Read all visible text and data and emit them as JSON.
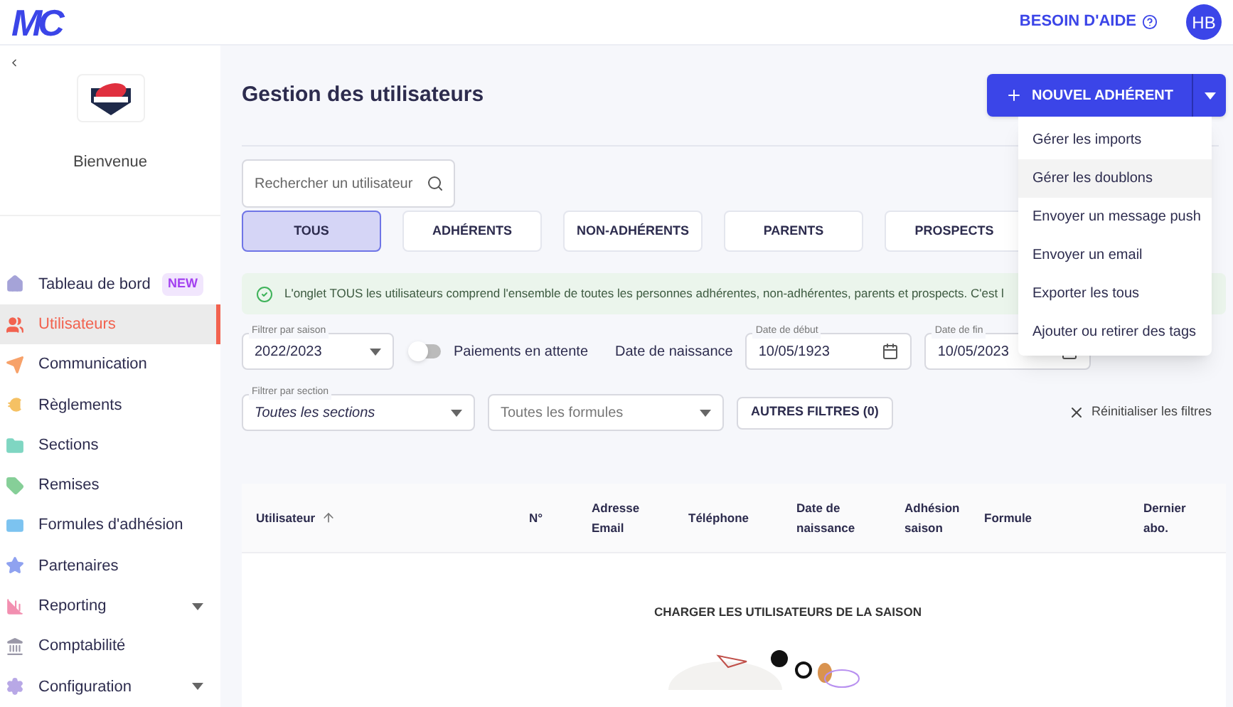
{
  "header": {
    "logo": "MC",
    "help": "BESOIN D'AIDE",
    "avatar": "HB"
  },
  "sidebar": {
    "welcome": "Bienvenue",
    "items": [
      {
        "label": "Tableau de bord",
        "selected": false,
        "badge": "NEW",
        "expandable": false
      },
      {
        "label": "Utilisateurs",
        "selected": true,
        "expandable": false
      },
      {
        "label": "Communication",
        "selected": false,
        "expandable": false
      },
      {
        "label": "Règlements",
        "selected": false,
        "expandable": false
      },
      {
        "label": "Sections",
        "selected": false,
        "expandable": false
      },
      {
        "label": "Remises",
        "selected": false,
        "expandable": false
      },
      {
        "label": "Formules d'adhésion",
        "selected": false,
        "expandable": false
      },
      {
        "label": "Partenaires",
        "selected": false,
        "expandable": false
      },
      {
        "label": "Reporting",
        "selected": false,
        "expandable": true
      },
      {
        "label": "Comptabilité",
        "selected": false,
        "expandable": false
      },
      {
        "label": "Configuration",
        "selected": false,
        "expandable": true
      }
    ]
  },
  "page": {
    "title": "Gestion des utilisateurs",
    "new_button": "NOUVEL ADHÉRENT"
  },
  "menu": [
    {
      "label": "Gérer les imports",
      "hovered": false
    },
    {
      "label": "Gérer les doublons",
      "hovered": true
    },
    {
      "label": "Envoyer un message push",
      "hovered": false
    },
    {
      "label": "Envoyer un email",
      "hovered": false
    },
    {
      "label": "Exporter les tous",
      "hovered": false
    },
    {
      "label": "Ajouter ou retirer des tags",
      "hovered": false
    }
  ],
  "search": {
    "placeholder": "Rechercher un utilisateur"
  },
  "tabs": [
    {
      "label": "TOUS",
      "selected": true
    },
    {
      "label": "ADHÉRENTS",
      "selected": false
    },
    {
      "label": "NON-ADHÉRENTS",
      "selected": false
    },
    {
      "label": "PARENTS",
      "selected": false
    },
    {
      "label": "PROSPECTS",
      "selected": false
    }
  ],
  "info": "L'onglet TOUS les utilisateurs comprend l'ensemble de toutes les personnes adhérentes, non-adhérentes, parents et prospects. C'est l",
  "filters": {
    "season": {
      "label": "Filtrer par saison",
      "value": "2022/2023"
    },
    "pending": {
      "label": "Paiements en attente",
      "on": false
    },
    "birth_label": "Date de naissance",
    "start": {
      "label": "Date de début",
      "value": "10/05/1923"
    },
    "end": {
      "label": "Date de fin",
      "value": "10/05/2023"
    },
    "section": {
      "label": "Filtrer par section",
      "value": "Toutes les sections"
    },
    "formula": {
      "placeholder": "Toutes les formules"
    },
    "more": "AUTRES FILTRES (0)",
    "reset": "Réinitialiser les filtres"
  },
  "table": {
    "columns": [
      "Utilisateur",
      "N°",
      "Adresse Email",
      "Téléphone",
      "Date de naissance",
      "Adhésion saison",
      "Formule",
      "Dernier abo."
    ],
    "load": "CHARGER LES UTILISATEURS DE LA SAISON"
  }
}
